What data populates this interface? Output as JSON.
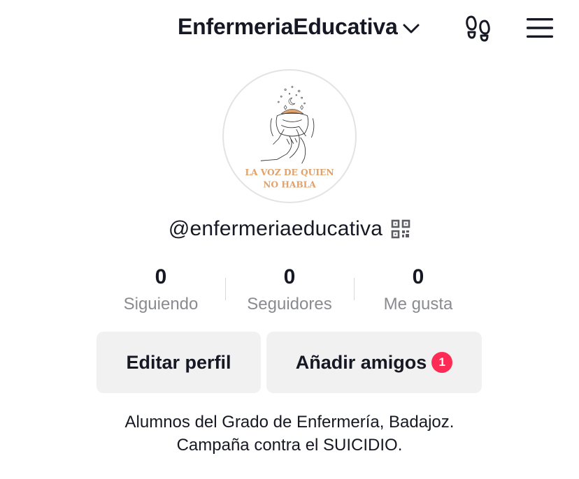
{
  "header": {
    "username": "EnfermeriaEducativa",
    "chevron_icon": "chevron-down-icon",
    "footprint_icon": "footprint-icon",
    "menu_icon": "hamburger-menu-icon"
  },
  "avatar": {
    "logo_line1": "LA VOZ DE QUIEN",
    "logo_line2": "NO HABLA"
  },
  "profile": {
    "handle": "@enfermeriaeducativa",
    "qr_icon": "qr-code-icon"
  },
  "stats": [
    {
      "value": "0",
      "label": "Siguiendo"
    },
    {
      "value": "0",
      "label": "Seguidores"
    },
    {
      "value": "0",
      "label": "Me gusta"
    }
  ],
  "actions": {
    "edit_label": "Editar perfil",
    "add_label": "Añadir amigos",
    "add_badge": "1"
  },
  "bio": {
    "line1": "Alumnos del Grado de Enfermería, Badajoz.",
    "line2": "Campaña contra el SUICIDIO."
  },
  "colors": {
    "text": "#161823",
    "muted": "#8a8b91",
    "button_bg": "#f1f1f2",
    "badge": "#fe2c55",
    "logo_accent": "#e0a16a"
  }
}
